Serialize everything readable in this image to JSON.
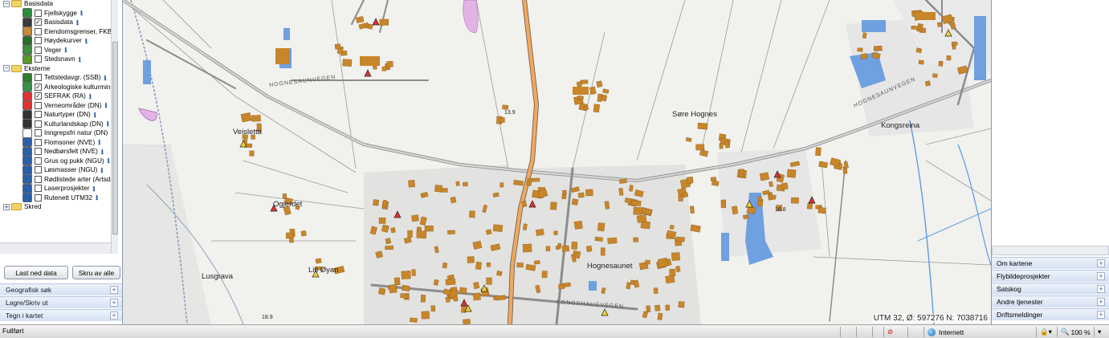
{
  "layers": {
    "groups": [
      {
        "label": "Basisdata",
        "items": [
          {
            "label": "Fjellskygge",
            "checked": false
          },
          {
            "label": "Basisdata",
            "checked": true
          },
          {
            "label": "Eiendomsgrenser, FKB",
            "checked": false
          },
          {
            "label": "Høydekurver",
            "checked": false
          },
          {
            "label": "Veger",
            "checked": false
          },
          {
            "label": "Stedsnavn",
            "checked": false
          }
        ]
      },
      {
        "label": "Eksterne",
        "items": [
          {
            "label": "Tettstedavgr. (SSB)",
            "checked": false
          },
          {
            "label": "Arkeologiske kulturminne",
            "checked": true
          },
          {
            "label": "SEFRAK (RA)",
            "checked": true
          },
          {
            "label": "Verneområder (DN)",
            "checked": false
          },
          {
            "label": "Naturtyper (DN)",
            "checked": false
          },
          {
            "label": "Kulturlandskap (DN)",
            "checked": false
          },
          {
            "label": "Inngrepsfri natur (DN)",
            "checked": false
          },
          {
            "label": "Flomsoner (NVE)",
            "checked": false
          },
          {
            "label": "Nedbørsfelt (NVE)",
            "checked": false
          },
          {
            "label": "Grus og pukk (NGU)",
            "checked": false
          },
          {
            "label": "Løsmasser (NGU)",
            "checked": false
          },
          {
            "label": "Rødlistede arter (Artsdat",
            "checked": false
          },
          {
            "label": "Laserprosjekter",
            "checked": false
          },
          {
            "label": "Rutenett UTM32",
            "checked": false
          }
        ]
      },
      {
        "label": "Skred",
        "items": []
      }
    ],
    "info_glyph": "ℹ"
  },
  "buttons": {
    "last_ned": "Last ned data",
    "skru_av": "Skru av alle"
  },
  "left_accordion": [
    "Geografisk søk",
    "Lagre/Skriv ut",
    "Tegn i kartet"
  ],
  "map": {
    "labels": [
      "Veisletta",
      "Søre Hognes",
      "Kongsreina",
      "Ogjerdet",
      "Liti Øyan",
      "Lusgrava",
      "Hognesaunet"
    ],
    "road_labels": [
      "HOGNESAUNVEGEN",
      "HOGNESAUNVEGEN",
      "KONGSHAUGVEGEN"
    ],
    "heights": [
      "13.9",
      "16.8",
      "18.9"
    ],
    "utm": "UTM 32, Ø: 597276 N: 7038716"
  },
  "right_accordion": [
    "Om kartene",
    "Flybildeprosjekter",
    "Satskog",
    "Andre tjenester",
    "Driftsmeldinger"
  ],
  "status": {
    "text": "Fullført",
    "zone": "Internett",
    "zoom": "100 %"
  },
  "colors": {
    "building": "#c8862a",
    "water_area": "#6fa0e0",
    "road_main": "#f2a75c",
    "accent": "#2c5fa8"
  }
}
